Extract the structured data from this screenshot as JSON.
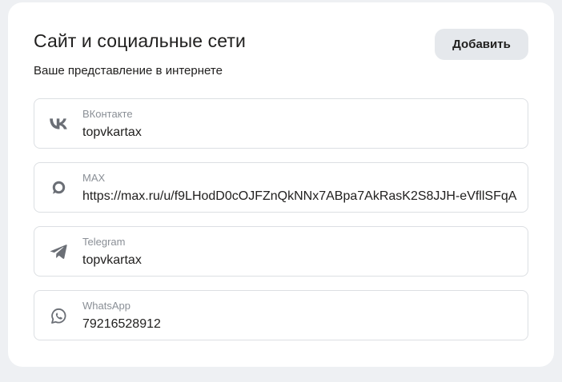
{
  "section": {
    "title": "Сайт и социальные сети",
    "subtitle": "Ваше представление в интернете",
    "add_button_label": "Добавить"
  },
  "fields": [
    {
      "icon": "vk-icon",
      "label": "ВКонтакте",
      "value": "topvkartax"
    },
    {
      "icon": "max-icon",
      "label": "MAX",
      "value": "https://max.ru/u/f9LHodD0cOJFZnQkNNx7ABpa7AkRasK2S8JJH-eVfllSFqA"
    },
    {
      "icon": "telegram-icon",
      "label": "Telegram",
      "value": "topvkartax"
    },
    {
      "icon": "whatsapp-icon",
      "label": "WhatsApp",
      "value": "79216528912"
    }
  ],
  "colors": {
    "background": "#eef0f3",
    "card": "#ffffff",
    "button": "#e5e8ec",
    "border": "#dcdfe3",
    "label": "#8a8f96",
    "icon": "#6b6f76"
  }
}
